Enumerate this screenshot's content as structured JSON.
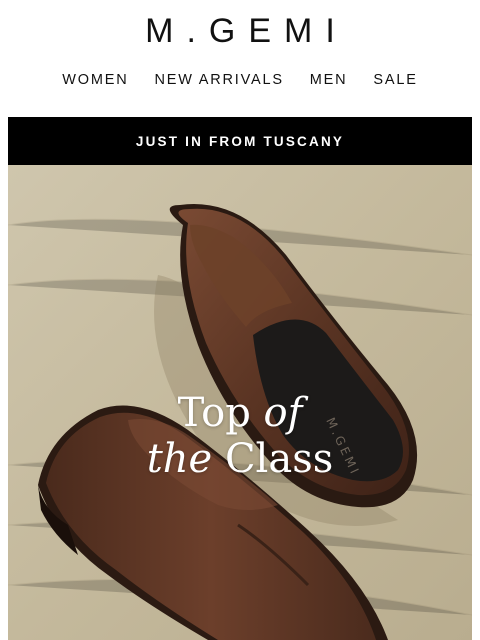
{
  "header": {
    "logo": "M.GEMI"
  },
  "nav": {
    "items": [
      "WOMEN",
      "NEW ARRIVALS",
      "MEN",
      "SALE"
    ]
  },
  "banner": {
    "text": "JUST IN FROM TUSCANY"
  },
  "hero": {
    "title_line1_a": "Top",
    "title_line1_b": "of",
    "title_line2_a": "the",
    "title_line2_b": "Class",
    "insole_brand": "M.GEMI",
    "colors": {
      "background": "#c8bea4",
      "leather": "#5a3423",
      "lining": "#1c1a19"
    }
  }
}
